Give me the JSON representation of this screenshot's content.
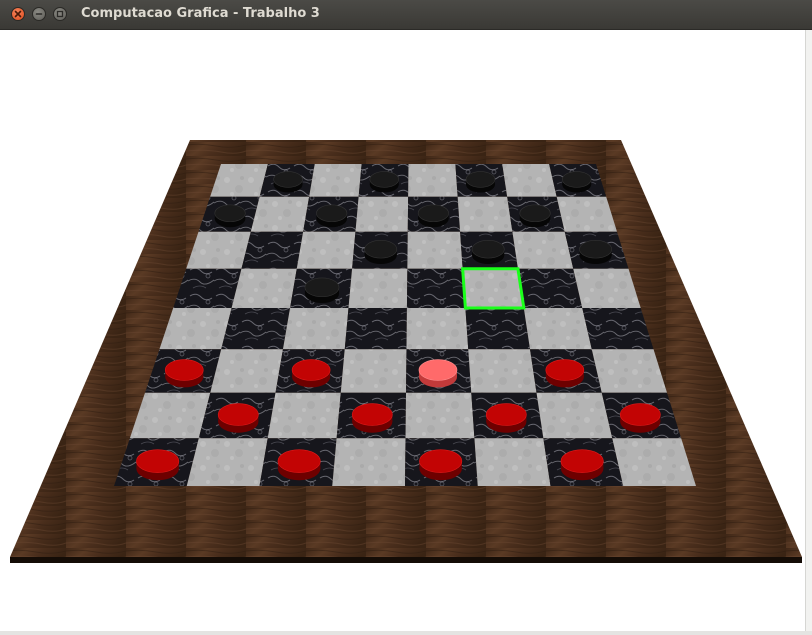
{
  "window": {
    "title": "Computacao Grafica - Trabalho 3",
    "buttons": [
      {
        "name": "close-button",
        "icon": "close-icon",
        "color": "#e8562a"
      },
      {
        "name": "minimize-button",
        "icon": "minimize-icon",
        "color": "#7a7974"
      },
      {
        "name": "maximize-button",
        "icon": "maximize-icon",
        "color": "#7a7974"
      }
    ]
  },
  "board": {
    "rows": 8,
    "cols": 8,
    "frame_color": "#4a2e1c",
    "light_square_color": "#b4b4b4",
    "dark_square_color": "#16161c",
    "selection_color": "#1aff1a",
    "selected_square": {
      "row": 3,
      "col": 5
    },
    "pieces": [
      {
        "row": 0,
        "col": 1,
        "color": "black"
      },
      {
        "row": 0,
        "col": 3,
        "color": "black"
      },
      {
        "row": 0,
        "col": 5,
        "color": "black"
      },
      {
        "row": 0,
        "col": 7,
        "color": "black"
      },
      {
        "row": 1,
        "col": 0,
        "color": "black"
      },
      {
        "row": 1,
        "col": 2,
        "color": "black"
      },
      {
        "row": 1,
        "col": 4,
        "color": "black"
      },
      {
        "row": 1,
        "col": 6,
        "color": "black"
      },
      {
        "row": 2,
        "col": 3,
        "color": "black"
      },
      {
        "row": 2,
        "col": 5,
        "color": "black"
      },
      {
        "row": 2,
        "col": 7,
        "color": "black"
      },
      {
        "row": 3,
        "col": 2,
        "color": "black"
      },
      {
        "row": 5,
        "col": 0,
        "color": "red"
      },
      {
        "row": 5,
        "col": 2,
        "color": "red"
      },
      {
        "row": 5,
        "col": 4,
        "color": "red",
        "highlighted": true
      },
      {
        "row": 5,
        "col": 6,
        "color": "red"
      },
      {
        "row": 6,
        "col": 1,
        "color": "red"
      },
      {
        "row": 6,
        "col": 3,
        "color": "red"
      },
      {
        "row": 6,
        "col": 5,
        "color": "red"
      },
      {
        "row": 6,
        "col": 7,
        "color": "red"
      },
      {
        "row": 7,
        "col": 0,
        "color": "red"
      },
      {
        "row": 7,
        "col": 2,
        "color": "red"
      },
      {
        "row": 7,
        "col": 4,
        "color": "red"
      },
      {
        "row": 7,
        "col": 6,
        "color": "red"
      }
    ]
  }
}
